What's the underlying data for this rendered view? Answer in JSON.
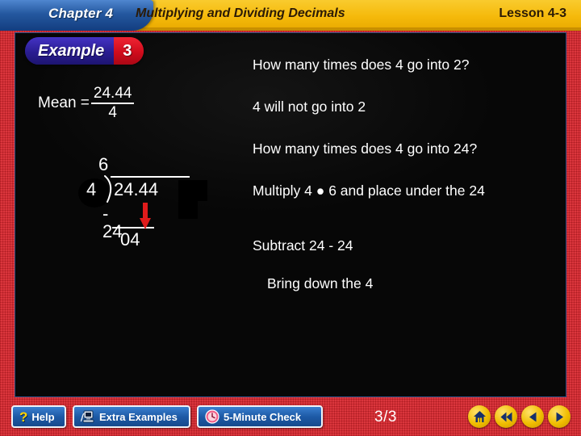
{
  "header": {
    "chapter": "Chapter 4",
    "title": "Multiplying and Dividing Decimals",
    "lesson": "Lesson 4-3"
  },
  "slide": {
    "example_word": "Example",
    "example_number": "3",
    "mean": {
      "label": "Mean =",
      "numerator": "24.44",
      "denominator": "4"
    },
    "long_division": {
      "quotient": "6",
      "divisor": "4",
      "dividend": "24.44",
      "subtrahend": "- 24",
      "remainder": "04",
      "arrow_icon": "bring-down-arrow-icon",
      "arrow_color": "#e01b1b"
    },
    "steps": [
      "How many times does 4 go into 2?",
      "4 will not go into 2",
      "How many times does 4 go into 24?",
      "Multiply 4 ● 6 and place under the 24",
      "Subtract 24 - 24",
      "Bring down  the 4"
    ]
  },
  "toolbar": {
    "help_label": "Help",
    "help_icon": "question-mark-icon",
    "extra_examples_label": "Extra Examples",
    "extra_examples_icon": "computer-monitor-icon",
    "five_minute_check_label": "5-Minute Check",
    "five_minute_check_icon": "clock-icon",
    "page_indicator": "3/3",
    "nav": {
      "home_icon": "home-icon",
      "first_icon": "double-left-arrow-icon",
      "prev_icon": "left-arrow-icon",
      "next_icon": "right-arrow-icon"
    }
  },
  "colors": {
    "border_red": "#d8232a",
    "header_gold": "#f6bd11",
    "chapter_blue": "#1f4f9c",
    "example_blue": "#2e1f9c",
    "example_red": "#d80d1e",
    "slide_black": "#080808",
    "button_blue": "#1f5fae",
    "nav_gold": "#f2c200"
  }
}
